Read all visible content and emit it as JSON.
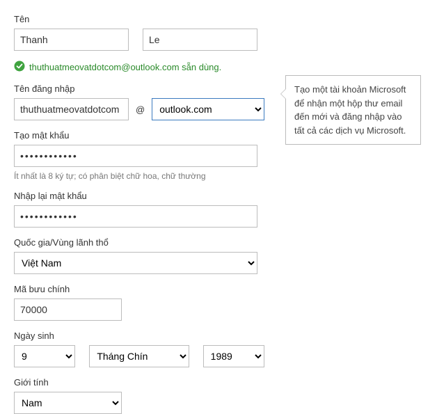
{
  "labels": {
    "name": "Tên",
    "signin": "Tên đăng nhập",
    "createpw": "Tạo mật khẩu",
    "reenterpw": "Nhập lại mật khẩu",
    "country": "Quốc gia/Vùng lãnh thổ",
    "postal": "Mã bưu chính",
    "dob": "Ngày sinh",
    "gender": "Giới tính"
  },
  "name": {
    "first": "Thanh",
    "last": "Le"
  },
  "availability": {
    "text": "thuthuatmeovatdotcom@outlook.com sẵn dùng."
  },
  "signin": {
    "username": "thuthuatmeovatdotcom",
    "at": "@",
    "domain": "outlook.com"
  },
  "password": {
    "value": "••••••••••••",
    "confirm": "••••••••••••"
  },
  "hint": "Ít nhất là 8 ký tự; có phân biệt chữ hoa, chữ thường",
  "country": "Việt Nam",
  "postal": "70000",
  "dob": {
    "day": "9",
    "month": "Tháng Chín",
    "year": "1989"
  },
  "gender": "Nam",
  "callout": "Tạo một tài khoản Microsoft để nhận một hộp thư email đến mới và đăng nhập vào tất cả các dịch vụ Microsoft."
}
